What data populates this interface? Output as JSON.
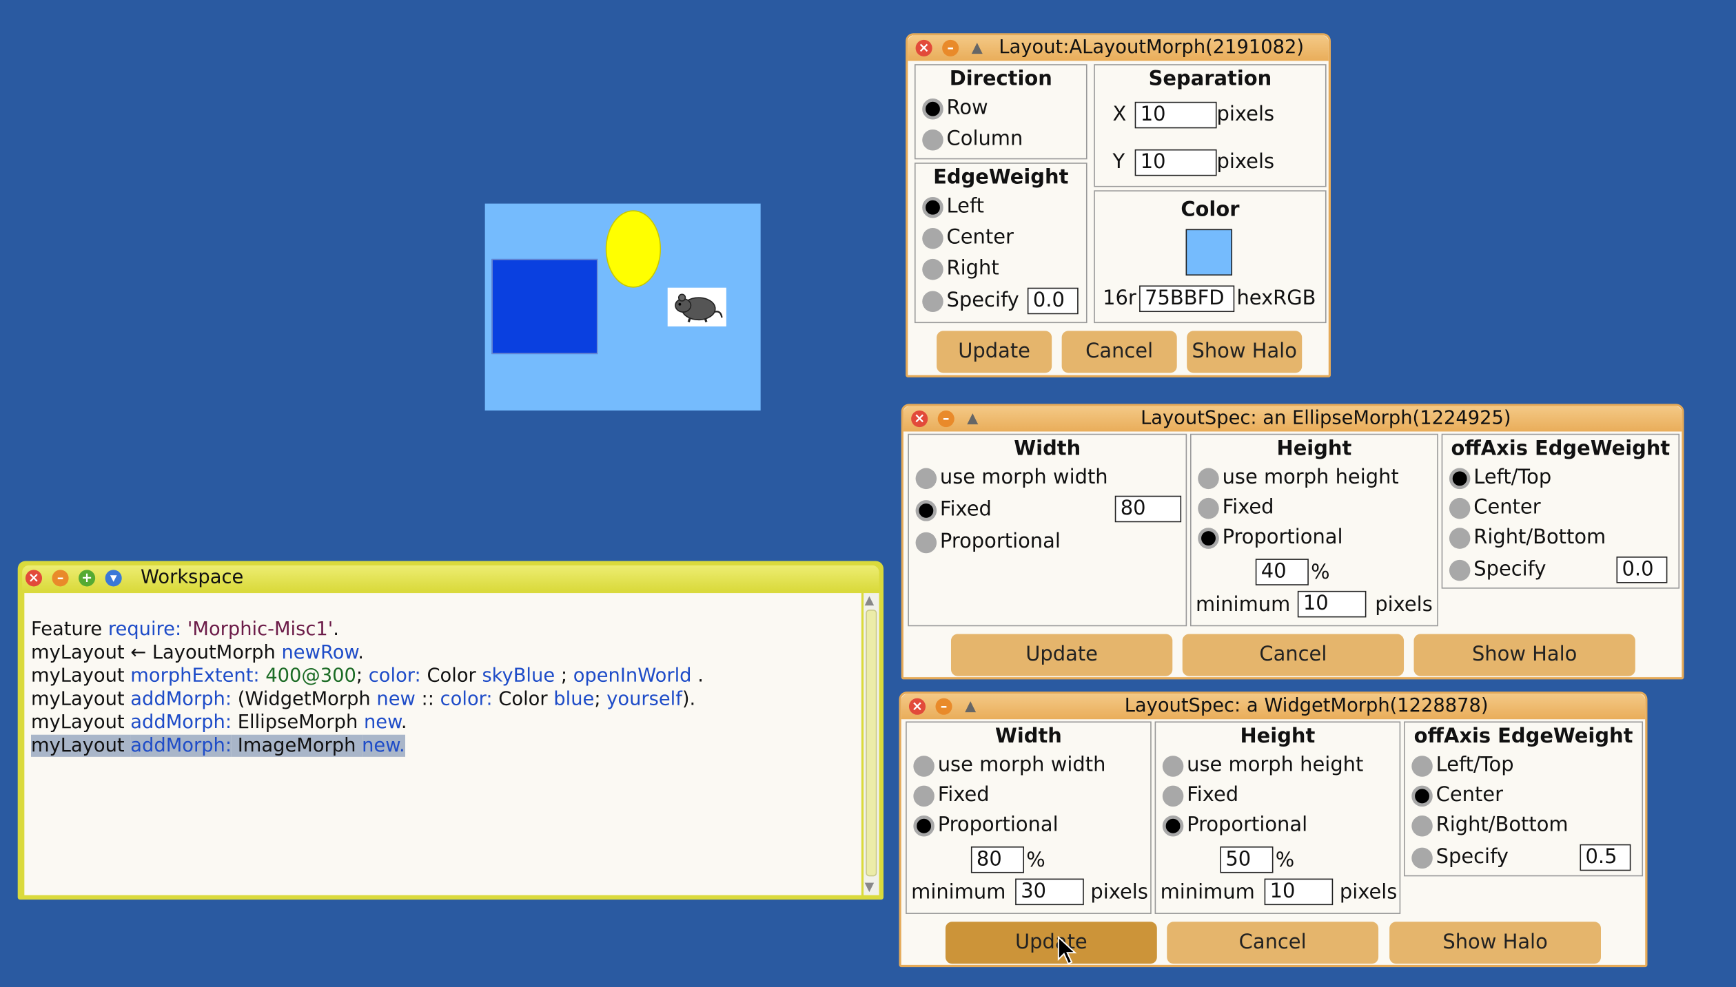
{
  "colors": {
    "desktop": "#2A5AA1",
    "morph_bg": "#75BBFD",
    "widget_blue": "#0A40E0",
    "ellipse_yellow": "#FFFF00"
  },
  "morph_world": {
    "image": "mouse-picture"
  },
  "layout_window": {
    "title": "Layout:ALayoutMorph(2191082)",
    "direction": {
      "header": "Direction",
      "row": "Row",
      "column": "Column",
      "selected": "Row"
    },
    "separation": {
      "header": "Separation",
      "x_label": "X",
      "x_value": "10",
      "y_label": "Y",
      "y_value": "10",
      "unit": "pixels"
    },
    "edge_weight": {
      "header": "EdgeWeight",
      "left": "Left",
      "center": "Center",
      "right": "Right",
      "specify": "Specify",
      "specify_value": "0.0",
      "selected": "Left"
    },
    "color": {
      "header": "Color",
      "prefix": "16r",
      "hex": "75BBFD",
      "suffix": "hexRGB"
    },
    "buttons": {
      "update": "Update",
      "cancel": "Cancel",
      "show_halo": "Show Halo"
    }
  },
  "ellipse_window": {
    "title": "LayoutSpec: an EllipseMorph(1224925)",
    "width": {
      "header": "Width",
      "use_morph": "use morph width",
      "fixed": "Fixed",
      "fixed_value": "80",
      "proportional": "Proportional",
      "selected": "Fixed"
    },
    "height": {
      "header": "Height",
      "use_morph": "use morph height",
      "fixed": "Fixed",
      "proportional": "Proportional",
      "percent": "40",
      "percent_sign": "%",
      "minimum_label": "minimum",
      "minimum": "10",
      "unit": "pixels",
      "selected": "Proportional"
    },
    "offaxis": {
      "header": "offAxis EdgeWeight",
      "left_top": "Left/Top",
      "center": "Center",
      "right_bottom": "Right/Bottom",
      "specify": "Specify",
      "specify_value": "0.0",
      "selected": "Left/Top"
    },
    "buttons": {
      "update": "Update",
      "cancel": "Cancel",
      "show_halo": "Show Halo"
    }
  },
  "widget_window": {
    "title": "LayoutSpec: a WidgetMorph(1228878)",
    "width": {
      "header": "Width",
      "use_morph": "use morph width",
      "fixed": "Fixed",
      "proportional": "Proportional",
      "percent": "80",
      "percent_sign": "%",
      "minimum_label": "minimum",
      "minimum": "30",
      "unit": "pixels",
      "selected": "Proportional"
    },
    "height": {
      "header": "Height",
      "use_morph": "use morph height",
      "fixed": "Fixed",
      "proportional": "Proportional",
      "percent": "50",
      "percent_sign": "%",
      "minimum_label": "minimum",
      "minimum": "10",
      "unit": "pixels",
      "selected": "Proportional"
    },
    "offaxis": {
      "header": "offAxis EdgeWeight",
      "left_top": "Left/Top",
      "center": "Center",
      "right_bottom": "Right/Bottom",
      "specify": "Specify",
      "specify_value": "0.5",
      "selected": "Center"
    },
    "buttons": {
      "update": "Update",
      "cancel": "Cancel",
      "show_halo": "Show Halo"
    }
  },
  "workspace": {
    "title": "Workspace",
    "lines": [
      [
        {
          "t": "Feature ",
          "c": ""
        },
        {
          "t": "require:",
          "c": "k"
        },
        {
          "t": " ",
          "c": ""
        },
        {
          "t": "'Morphic-Misc1'",
          "c": "s"
        },
        {
          "t": ".",
          "c": ""
        }
      ],
      [
        {
          "t": "myLayout ← LayoutMorph ",
          "c": ""
        },
        {
          "t": "newRow",
          "c": "k"
        },
        {
          "t": ".",
          "c": ""
        }
      ],
      [
        {
          "t": "myLayout ",
          "c": ""
        },
        {
          "t": "morphExtent:",
          "c": "k"
        },
        {
          "t": " ",
          "c": ""
        },
        {
          "t": "400@300",
          "c": "n"
        },
        {
          "t": "; ",
          "c": ""
        },
        {
          "t": "color:",
          "c": "k"
        },
        {
          "t": " Color ",
          "c": ""
        },
        {
          "t": "skyBlue",
          "c": "k"
        },
        {
          "t": " ; ",
          "c": ""
        },
        {
          "t": "openInWorld",
          "c": "k"
        },
        {
          "t": " .",
          "c": ""
        }
      ],
      [
        {
          "t": "myLayout ",
          "c": ""
        },
        {
          "t": "addMorph:",
          "c": "k"
        },
        {
          "t": " (WidgetMorph ",
          "c": ""
        },
        {
          "t": "new",
          "c": "k"
        },
        {
          "t": " :: ",
          "c": ""
        },
        {
          "t": "color:",
          "c": "k"
        },
        {
          "t": " Color ",
          "c": ""
        },
        {
          "t": "blue",
          "c": "k"
        },
        {
          "t": "; ",
          "c": ""
        },
        {
          "t": "yourself",
          "c": "k"
        },
        {
          "t": ").",
          "c": ""
        }
      ],
      [
        {
          "t": "myLayout ",
          "c": ""
        },
        {
          "t": "addMorph:",
          "c": "k"
        },
        {
          "t": " EllipseMorph ",
          "c": ""
        },
        {
          "t": "new",
          "c": "k"
        },
        {
          "t": ".",
          "c": ""
        }
      ],
      [
        {
          "t": "myLayout ",
          "c": "sel"
        },
        {
          "t": "addMorph:",
          "c": "k sel"
        },
        {
          "t": " ImageMorph ",
          "c": "sel"
        },
        {
          "t": "new.",
          "c": "k sel"
        }
      ]
    ]
  }
}
